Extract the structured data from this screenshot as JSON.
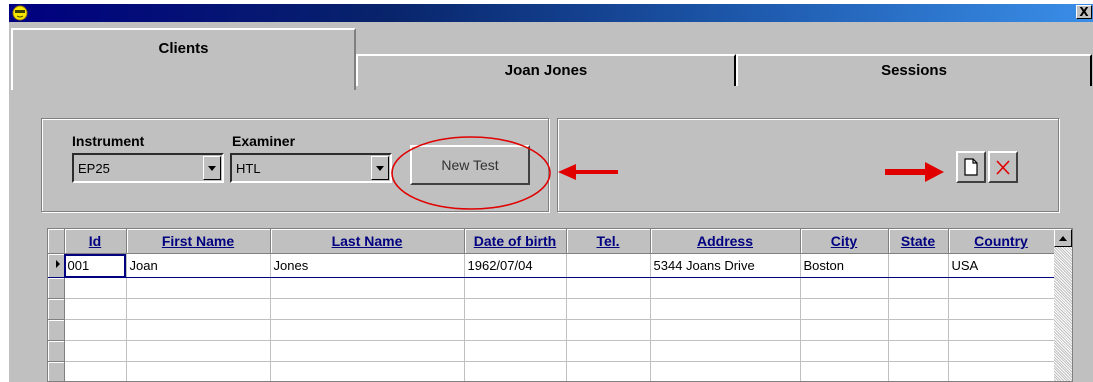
{
  "window": {
    "close_glyph": "X"
  },
  "tabs": [
    {
      "label": "Clients",
      "active": true
    },
    {
      "label": "Joan Jones",
      "active": false
    },
    {
      "label": "Sessions",
      "active": false
    }
  ],
  "form": {
    "instrument_label": "Instrument",
    "instrument_value": "EP25",
    "examiner_label": "Examiner",
    "examiner_value": "HTL",
    "new_test_label": "New Test"
  },
  "toolbar": {
    "new_icon": "new-document-icon",
    "delete_icon": "delete-x-icon"
  },
  "grid": {
    "columns": [
      "Id",
      "First Name",
      "Last Name",
      "Date of birth",
      "Tel.",
      "Address",
      "City",
      "State",
      "Country"
    ],
    "rows": [
      [
        "001",
        "Joan",
        "Jones",
        "1962/07/04",
        "",
        "5344 Joans Drive",
        "Boston",
        "",
        "USA"
      ],
      [
        "",
        "",
        "",
        "",
        "",
        "",
        "",
        "",
        ""
      ],
      [
        "",
        "",
        "",
        "",
        "",
        "",
        "",
        "",
        ""
      ],
      [
        "",
        "",
        "",
        "",
        "",
        "",
        "",
        "",
        ""
      ],
      [
        "",
        "",
        "",
        "",
        "",
        "",
        "",
        "",
        ""
      ],
      [
        "",
        "",
        "",
        "",
        "",
        "",
        "",
        "",
        ""
      ]
    ]
  },
  "colors": {
    "titlebar": "#000080",
    "face": "#c0c0c0",
    "annotation": "#e00000",
    "header_text": "#000080"
  }
}
